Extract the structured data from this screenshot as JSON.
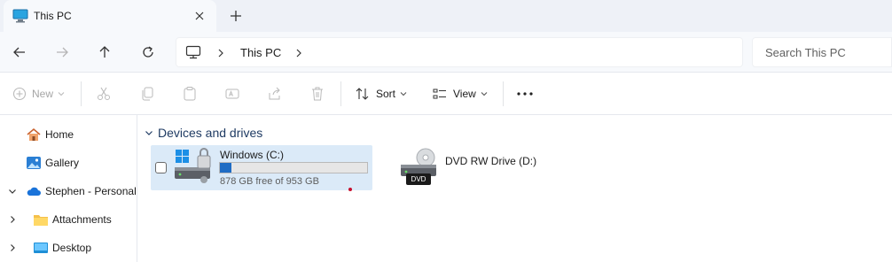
{
  "tab": {
    "title": "This PC",
    "close_icon": "close-icon",
    "new_tab_icon": "plus-icon"
  },
  "nav": {
    "back_icon": "arrow-left-icon",
    "forward_icon": "arrow-right-icon",
    "up_icon": "arrow-up-icon",
    "refresh_icon": "refresh-icon",
    "address": {
      "location_icon": "monitor-icon",
      "path": "This PC"
    },
    "search": {
      "placeholder": "Search This PC"
    }
  },
  "commands": {
    "new_label": "New",
    "sort_label": "Sort",
    "view_label": "View",
    "more_icon": "more-icon"
  },
  "sidebar": {
    "items": [
      {
        "label": "Home",
        "icon": "home-icon"
      },
      {
        "label": "Gallery",
        "icon": "gallery-icon"
      },
      {
        "label": "Stephen - Personal",
        "icon": "cloud-icon",
        "expanded": true
      },
      {
        "label": "Attachments",
        "icon": "folder-icon"
      },
      {
        "label": "Desktop",
        "icon": "desktop-icon"
      }
    ]
  },
  "main": {
    "group_title": "Devices and drives",
    "drives": [
      {
        "name": "Windows (C:)",
        "free_text": "878 GB free of 953 GB",
        "used_fraction": 0.079,
        "selected": true
      },
      {
        "name": "DVD RW Drive (D:)",
        "badge": "DVD"
      }
    ]
  },
  "colors": {
    "accent": "#1f6cc4",
    "selection": "#dbeaf8",
    "group_title": "#1f3b63"
  }
}
